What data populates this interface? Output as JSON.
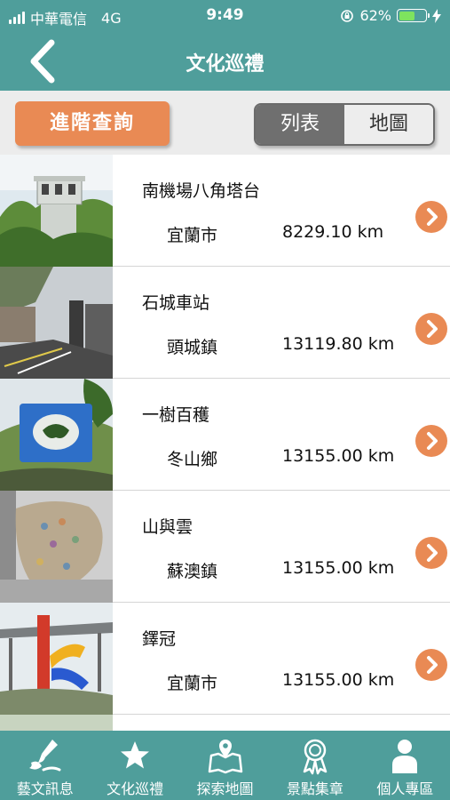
{
  "status": {
    "carrier": "中華電信",
    "network": "4G",
    "time": "9:49",
    "battery": "62%",
    "battery_level": 0.62
  },
  "nav": {
    "title": "文化巡禮",
    "back_icon": "chevron-left-icon"
  },
  "controls": {
    "advanced_query": "進階查詢",
    "view_list": "列表",
    "view_map": "地圖",
    "selected_view": "列表"
  },
  "places": [
    {
      "name": "南機場八角塔台",
      "town": "宜蘭市",
      "distance": "8229.10 km"
    },
    {
      "name": "石城車站",
      "town": "頭城鎮",
      "distance": "13119.80 km"
    },
    {
      "name": "一樹百穫",
      "town": "冬山鄉",
      "distance": "13155.00 km"
    },
    {
      "name": "山與雲",
      "town": "蘇澳鎮",
      "distance": "13155.00 km"
    },
    {
      "name": "鐸冠",
      "town": "宜蘭市",
      "distance": "13155.00 km"
    }
  ],
  "tabs": [
    {
      "label": "藝文訊息",
      "icon": "art-brush-icon"
    },
    {
      "label": "文化巡禮",
      "icon": "star-icon"
    },
    {
      "label": "探索地圖",
      "icon": "map-pin-icon"
    },
    {
      "label": "景點集章",
      "icon": "badge-icon"
    },
    {
      "label": "個人專區",
      "icon": "person-icon"
    }
  ],
  "colors": {
    "primary": "#4f9e9b",
    "accent": "#e98a54",
    "segment_active": "#6f6f6f"
  }
}
